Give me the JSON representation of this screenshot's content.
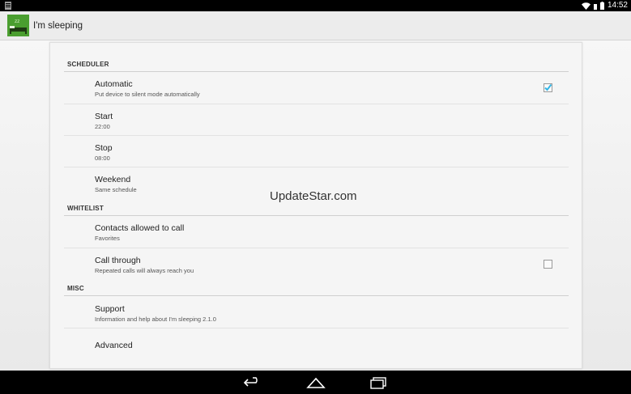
{
  "status_bar": {
    "time": "14:52",
    "icons": [
      "notification-icon",
      "wifi-icon",
      "signal-icon",
      "battery-icon"
    ]
  },
  "action_bar": {
    "app_icon": "sleeping-bed-icon",
    "title": "I'm sleeping"
  },
  "sections": {
    "scheduler": "SCHEDULER",
    "whitelist": "WHITELIST",
    "misc": "MISC"
  },
  "prefs": {
    "automatic": {
      "title": "Automatic",
      "summary": "Put device to silent mode automatically",
      "checked": true
    },
    "start": {
      "title": "Start",
      "summary": "22:00"
    },
    "stop": {
      "title": "Stop",
      "summary": "08:00"
    },
    "weekend": {
      "title": "Weekend",
      "summary": "Same schedule"
    },
    "contacts": {
      "title": "Contacts allowed to call",
      "summary": "Favorites"
    },
    "call_through": {
      "title": "Call through",
      "summary": "Repeated calls will always reach you",
      "checked": false
    },
    "support": {
      "title": "Support",
      "summary": "Information and help about I'm sleeping 2.1.0"
    },
    "advanced": {
      "title": "Advanced"
    }
  },
  "watermark": "UpdateStar.com",
  "nav_bar": {
    "icons": [
      "back-icon",
      "home-icon",
      "recent-apps-icon"
    ]
  },
  "colors": {
    "accent": "#33b5e5",
    "app_icon_green": "#4a9e2f"
  }
}
